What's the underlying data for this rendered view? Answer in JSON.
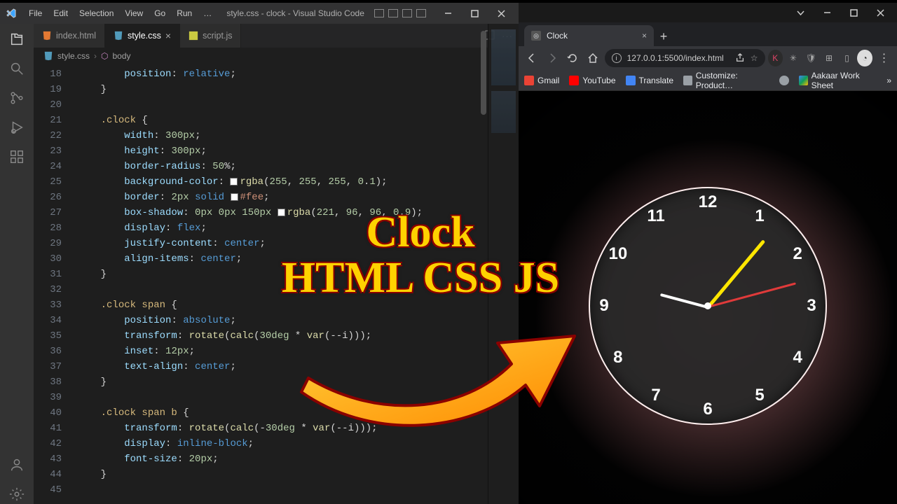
{
  "vscode": {
    "menu": [
      "File",
      "Edit",
      "Selection",
      "View",
      "Go",
      "Run",
      "…"
    ],
    "window_title": "style.css - clock - Visual Studio Code",
    "tabs": [
      {
        "label": "index.html",
        "icon": "html",
        "active": false
      },
      {
        "label": "style.css",
        "icon": "css",
        "active": true
      },
      {
        "label": "script.js",
        "icon": "js",
        "active": false
      }
    ],
    "breadcrumbs": {
      "file": "style.css",
      "symbol": "body"
    },
    "line_start": 18,
    "code_lines": [
      "        position: relative;",
      "    }",
      "",
      "    .clock {",
      "        width: 300px;",
      "        height: 300px;",
      "        border-radius: 50%;",
      "        background-color: ␣rgba(255, 255, 255, 0.1);",
      "        border: 2px solid ␣#fee;",
      "        box-shadow: 0px 0px 150px ␣rgba(221, 96, 96, 0.9);",
      "        display: flex;",
      "        justify-content: center;",
      "        align-items: center;",
      "    }",
      "",
      "    .clock span {",
      "        position: absolute;",
      "        transform: rotate(calc(30deg * var(--i)));",
      "        inset: 12px;",
      "        text-align: center;",
      "    }",
      "",
      "    .clock span b {",
      "        transform: rotate(calc(-30deg * var(--i)));",
      "        display: inline-block;",
      "        font-size: 20px;",
      "    }",
      ""
    ]
  },
  "browser": {
    "tab_title": "Clock",
    "url": "127.0.0.1:5500/index.html",
    "bookmarks": [
      {
        "label": "Gmail",
        "color": "#ea4335"
      },
      {
        "label": "YouTube",
        "color": "#ff0000"
      },
      {
        "label": "Translate",
        "color": "#4285f4"
      },
      {
        "label": "Customize: Product…",
        "color": "#9aa0a6"
      },
      {
        "label": "",
        "color": "#9aa0a6"
      },
      {
        "label": "Aakaar Work Sheet",
        "color": "#0f9d58"
      }
    ]
  },
  "overlay": {
    "line1": "Clock",
    "line2": "HTML CSS JS"
  },
  "clock": {
    "numerals": [
      "12",
      "1",
      "2",
      "3",
      "4",
      "5",
      "6",
      "7",
      "8",
      "9",
      "10",
      "11"
    ],
    "hour_angle_deg": -165,
    "minute_angle_deg": -50,
    "second_angle_deg": -15
  },
  "colors": {
    "vscode_bg": "#1e1e1e",
    "accent_glow": "rgba(221,96,96,0.9)",
    "overlay_text": "#ffd200"
  }
}
